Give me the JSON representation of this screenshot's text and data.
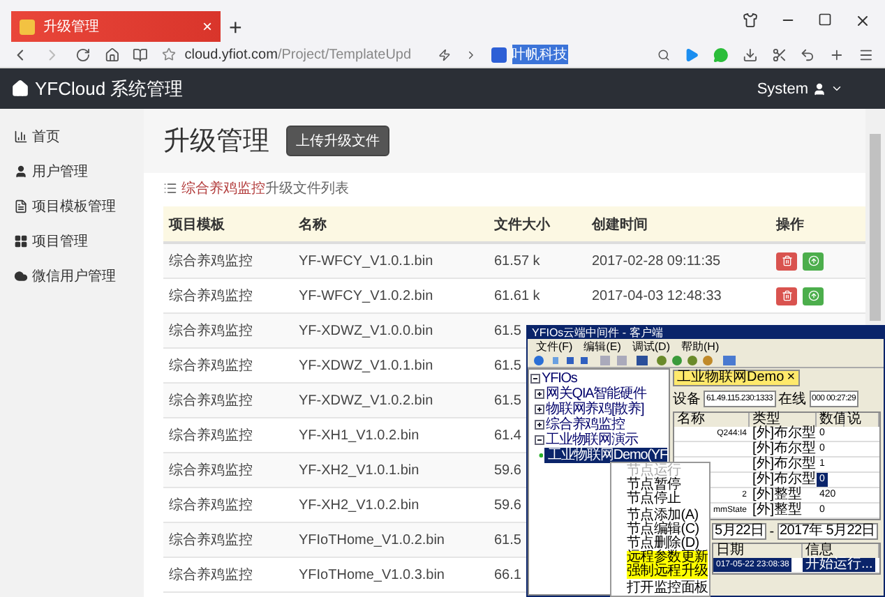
{
  "browser": {
    "tab": {
      "title": "升级管理",
      "close": "×"
    },
    "new_tab": "+",
    "address": {
      "host": "cloud.yfiot.com",
      "path": "/Project/TemplateUpd"
    },
    "search": {
      "value": "叶帆科技"
    }
  },
  "app_bar": {
    "brand": "YFCloud 系统管理",
    "user": "System"
  },
  "sidebar": {
    "items": [
      {
        "label": "首页",
        "kind": "chart"
      },
      {
        "label": "用户管理",
        "kind": "user"
      },
      {
        "label": "项目模板管理",
        "kind": "file"
      },
      {
        "label": "项目管理",
        "kind": "grid"
      },
      {
        "label": "微信用户管理",
        "kind": "cloud"
      }
    ]
  },
  "page": {
    "title": "升级管理",
    "upload_button": "上传升级文件",
    "caption_project": "综合养鸡监控",
    "caption_suffix": "升级文件列表"
  },
  "table": {
    "columns": [
      "项目模板",
      "名称",
      "文件大小",
      "创建时间",
      "操作"
    ],
    "rows": [
      {
        "template": "综合养鸡监控",
        "name": "YF-WFCY_V1.0.1.bin",
        "size": "61.57 k",
        "created": "2017-02-28 09:11:35",
        "actions": true
      },
      {
        "template": "综合养鸡监控",
        "name": "YF-WFCY_V1.0.2.bin",
        "size": "61.61 k",
        "created": "2017-04-03 12:48:33",
        "actions": true
      },
      {
        "template": "综合养鸡监控",
        "name": "YF-XDWZ_V1.0.0.bin",
        "size": "61.5"
      },
      {
        "template": "综合养鸡监控",
        "name": "YF-XDWZ_V1.0.1.bin",
        "size": "61.5"
      },
      {
        "template": "综合养鸡监控",
        "name": "YF-XDWZ_V1.0.2.bin",
        "size": "61.5"
      },
      {
        "template": "综合养鸡监控",
        "name": "YF-XH1_V1.0.2.bin",
        "size": "61.4"
      },
      {
        "template": "综合养鸡监控",
        "name": "YF-XH2_V1.0.1.bin",
        "size": "59.6"
      },
      {
        "template": "综合养鸡监控",
        "name": "YF-XH2_V1.0.2.bin",
        "size": "59.6"
      },
      {
        "template": "综合养鸡监控",
        "name": "YFIoTHome_V1.0.2.bin",
        "size": "61.5"
      },
      {
        "template": "综合养鸡监控",
        "name": "YFIoTHome_V1.0.3.bin",
        "size": "66.1"
      }
    ]
  },
  "client_window": {
    "title": "YFIOs云端中间件 - 客户端",
    "menus": [
      "文件(F)",
      "编辑(E)",
      "调试(D)",
      "帮助(H)"
    ],
    "tree": {
      "label": "YFIOs",
      "expanded": true,
      "selected": false,
      "children": [
        {
          "label": "网关QIA智能硬件",
          "expanded": false,
          "selected": false
        },
        {
          "label": "物联网养鸡[散养]",
          "expanded": false,
          "selected": false
        },
        {
          "label": "综合养鸡监控",
          "expanded": false,
          "selected": false
        },
        {
          "label": "工业物联网演示",
          "expanded": true,
          "selected": false,
          "children": [
            {
              "label": "工业物联网Demo(YF",
              "selected": true
            }
          ]
        }
      ]
    },
    "doc_tab": {
      "label": "工业物联网Demo",
      "close": "×"
    },
    "device_label": "设备",
    "device_value": "61.49.115.230:1333",
    "online_label": "在线",
    "online_value": "000 00:27:29",
    "grid": {
      "columns": [
        "名称",
        "类型",
        "数值",
        "说"
      ],
      "rows": [
        {
          "name": "Q244:I4",
          "type": "[外]布尔型",
          "value": "0",
          "selected": false
        },
        {
          "name": "",
          "type": "[外]布尔型",
          "value": "0",
          "selected": false
        },
        {
          "name": "",
          "type": "[外]布尔型",
          "value": "1",
          "selected": false
        },
        {
          "name": "",
          "type": "[外]布尔型",
          "value": "0",
          "selected": true
        },
        {
          "name": "2",
          "type": "[外]整型",
          "value": "420",
          "selected": false
        },
        {
          "name": "mmState",
          "type": "[外]整型",
          "value": "0",
          "selected": false
        }
      ]
    },
    "date_from": "5月22日",
    "date_sep": "-",
    "date_to": "2017年 5月22日",
    "log": {
      "columns": [
        "日期",
        "信息"
      ],
      "rows": [
        {
          "date": "017-05-22 23:08:38",
          "message": "开始运行...",
          "selected": true
        }
      ]
    }
  },
  "context_menu": {
    "items": [
      {
        "label": "节点运行",
        "disabled": true,
        "highlighted": false,
        "separator_after": false
      },
      {
        "label": "节点暂停",
        "disabled": false,
        "highlighted": false,
        "separator_after": false
      },
      {
        "label": "节点停止",
        "disabled": false,
        "highlighted": false,
        "separator_after": true
      },
      {
        "label": "节点添加(A)",
        "disabled": false,
        "highlighted": false,
        "separator_after": false
      },
      {
        "label": "节点编辑(C)",
        "disabled": false,
        "highlighted": false,
        "separator_after": false
      },
      {
        "label": "节点删除(D)",
        "disabled": false,
        "highlighted": false,
        "separator_after": false
      },
      {
        "label": "远程参数更新",
        "disabled": false,
        "highlighted": true,
        "separator_after": false
      },
      {
        "label": "强制远程升级",
        "disabled": false,
        "highlighted": true,
        "separator_after": true
      },
      {
        "label": "打开监控面板",
        "disabled": false,
        "highlighted": false,
        "separator_after": false
      }
    ]
  }
}
